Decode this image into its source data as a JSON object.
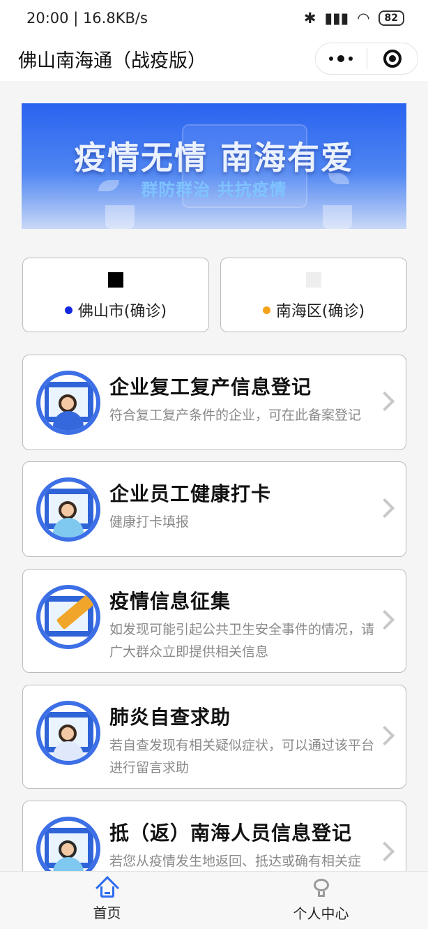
{
  "status_bar": {
    "time_speed": "20:00 | 16.8KB/s",
    "battery": "82",
    "icons": [
      "mute-icon",
      "alarm-icon",
      "bluetooth-icon",
      "signal-icon",
      "wifi-icon",
      "battery-icon"
    ]
  },
  "nav": {
    "title": "佛山南海通（战疫版）",
    "more_icon": "more-dots-icon",
    "close_icon": "target-close-icon"
  },
  "banner": {
    "title": "疫情无情 南海有爱",
    "subtitle": "群防群治 共抗疫情"
  },
  "stats": [
    {
      "label": "佛山市(确诊)",
      "dot_color": "#1428e0",
      "value_color": "#000000"
    },
    {
      "label": "南海区(确诊)",
      "dot_color": "#f4a21a",
      "value_color": "#eeeeee"
    }
  ],
  "cards": [
    {
      "title": "企业复工复产信息登记",
      "desc": "符合复工复产条件的企业，可在此备案登记",
      "icon": "enterprise-registration-icon"
    },
    {
      "title": "企业员工健康打卡",
      "desc": "健康打卡填报",
      "icon": "health-checkin-icon"
    },
    {
      "title": "疫情信息征集",
      "desc": "如发现可能引起公共卫生安全事件的情况，请广大群众立即提供相关信息",
      "icon": "info-collection-icon"
    },
    {
      "title": "肺炎自查求助",
      "desc": "若自查发现有相关疑似症状，可以通过该平台进行留言求助",
      "icon": "self-check-icon"
    },
    {
      "title": "抵（返）南海人员信息登记",
      "desc": "若您从疫情发生地返回、抵达或确有相关症",
      "icon": "traveler-registration-icon"
    }
  ],
  "tabbar": [
    {
      "label": "首页",
      "icon": "home-icon",
      "color": "#2c6cf0"
    },
    {
      "label": "个人中心",
      "icon": "user-center-icon",
      "color": "#9a9a9a"
    }
  ]
}
